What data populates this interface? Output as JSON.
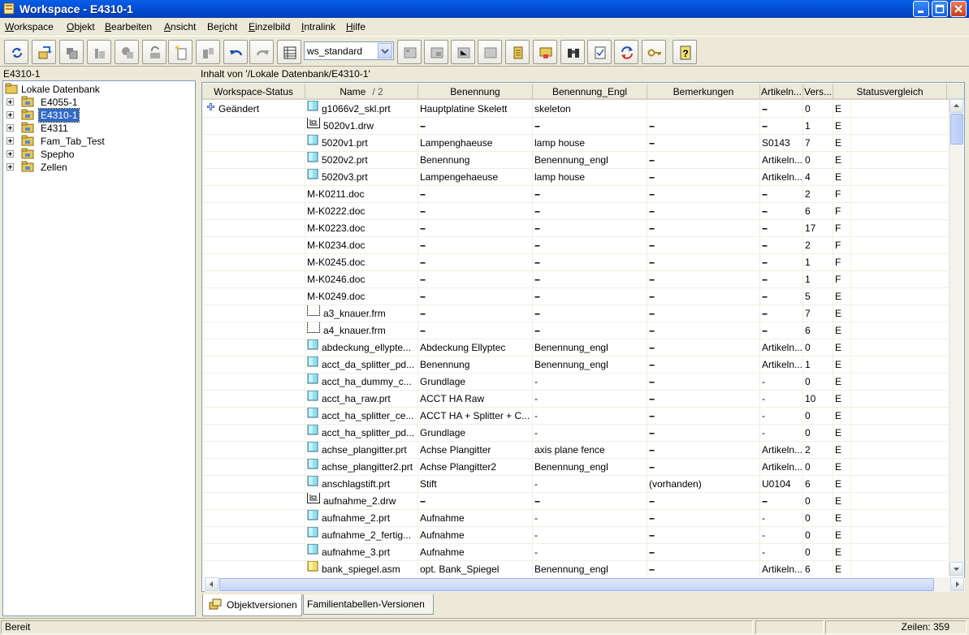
{
  "window": {
    "title": "Workspace - E4310-1"
  },
  "menu": [
    {
      "label": "Workspace",
      "ul": "W",
      "rest": "orkspace"
    },
    {
      "label": "Objekt",
      "ul": "O",
      "rest": "bjekt"
    },
    {
      "label": "Bearbeiten",
      "ul": "B",
      "rest": "earbeiten"
    },
    {
      "label": "Ansicht",
      "ul": "A",
      "rest": "nsicht"
    },
    {
      "label": "Bericht",
      "pre": "Be",
      "ul": "r",
      "rest": "icht"
    },
    {
      "label": "Einzelbild",
      "ul": "E",
      "rest": "inzelbild"
    },
    {
      "label": "Intralink",
      "ul": "I",
      "rest": "ntralink"
    },
    {
      "label": "Hilfe",
      "ul": "H",
      "rest": "ilfe"
    }
  ],
  "toolbar": {
    "view_select": {
      "value": "ws_standard"
    }
  },
  "tree": {
    "header": "E4310-1",
    "root": "Lokale Datenbank",
    "items": [
      "E4055-1",
      "E4310-1",
      "E4311",
      "Fam_Tab_Test",
      "Spepho",
      "Zellen"
    ],
    "selected": "E4310-1"
  },
  "content": {
    "path_label": "Inhalt von '/Lokale Datenbank/E4310-1'",
    "columns": [
      "Workspace-Status",
      "Name",
      "Benennung",
      "Benennung_Engl",
      "Bemerkungen",
      "Artikeln...",
      "Vers...",
      "Statusvergleich"
    ],
    "name_sort": "/  2",
    "rows": [
      {
        "status": "Geändert",
        "icon": "part",
        "name": "g1066v2_skl.prt",
        "ben": "Hauptplatine Skelett",
        "ben_engl": "skeleton",
        "bem": "",
        "art": "--",
        "ver": "0",
        "sv": "E"
      },
      {
        "status": "",
        "icon": "drawing",
        "name": "5020v1.drw",
        "ben": "--",
        "ben_engl": "--",
        "bem": "--",
        "art": "--",
        "ver": "1",
        "sv": "E"
      },
      {
        "status": "",
        "icon": "part",
        "name": "5020v1.prt",
        "ben": "Lampenghaeuse",
        "ben_engl": "lamp house",
        "bem": "--",
        "art": "S0143",
        "ver": "7",
        "sv": "E"
      },
      {
        "status": "",
        "icon": "part",
        "name": "5020v2.prt",
        "ben": "Benennung",
        "ben_engl": "Benennung_engl",
        "bem": "--",
        "art": "Artikeln...",
        "ver": "0",
        "sv": "E"
      },
      {
        "status": "",
        "icon": "part",
        "name": "5020v3.prt",
        "ben": "Lampengehaeuse",
        "ben_engl": "lamp house",
        "bem": "--",
        "art": "Artikeln...",
        "ver": "4",
        "sv": "E"
      },
      {
        "status": "",
        "icon": "",
        "name": "M-K0211.doc",
        "ben": "--",
        "ben_engl": "--",
        "bem": "--",
        "art": "--",
        "ver": "2",
        "sv": "F"
      },
      {
        "status": "",
        "icon": "",
        "name": "M-K0222.doc",
        "ben": "--",
        "ben_engl": "--",
        "bem": "--",
        "art": "--",
        "ver": "6",
        "sv": "F"
      },
      {
        "status": "",
        "icon": "",
        "name": "M-K0223.doc",
        "ben": "--",
        "ben_engl": "--",
        "bem": "--",
        "art": "--",
        "ver": "17",
        "sv": "F"
      },
      {
        "status": "",
        "icon": "",
        "name": "M-K0234.doc",
        "ben": "--",
        "ben_engl": "--",
        "bem": "--",
        "art": "--",
        "ver": "2",
        "sv": "F"
      },
      {
        "status": "",
        "icon": "",
        "name": "M-K0245.doc",
        "ben": "--",
        "ben_engl": "--",
        "bem": "--",
        "art": "--",
        "ver": "1",
        "sv": "F"
      },
      {
        "status": "",
        "icon": "",
        "name": "M-K0246.doc",
        "ben": "--",
        "ben_engl": "--",
        "bem": "--",
        "art": "--",
        "ver": "1",
        "sv": "F"
      },
      {
        "status": "",
        "icon": "",
        "name": "M-K0249.doc",
        "ben": "--",
        "ben_engl": "--",
        "bem": "--",
        "art": "--",
        "ver": "5",
        "sv": "E"
      },
      {
        "status": "",
        "icon": "format",
        "name": "a3_knauer.frm",
        "ben": "--",
        "ben_engl": "--",
        "bem": "--",
        "art": "--",
        "ver": "7",
        "sv": "E"
      },
      {
        "status": "",
        "icon": "format",
        "name": "a4_knauer.frm",
        "ben": "--",
        "ben_engl": "--",
        "bem": "--",
        "art": "--",
        "ver": "6",
        "sv": "E"
      },
      {
        "status": "",
        "icon": "part",
        "name": "abdeckung_ellypte...",
        "ben": "Abdeckung Ellyptec",
        "ben_engl": "Benennung_engl",
        "bem": "--",
        "art": "Artikeln...",
        "ver": "0",
        "sv": "E"
      },
      {
        "status": "",
        "icon": "part",
        "name": "acct_da_splitter_pd...",
        "ben": "Benennung",
        "ben_engl": "Benennung_engl",
        "bem": "--",
        "art": "Artikeln...",
        "ver": "1",
        "sv": "E"
      },
      {
        "status": "",
        "icon": "part",
        "name": "acct_ha_dummy_c...",
        "ben": "Grundlage",
        "ben_engl": "-",
        "bem": "--",
        "art": "-",
        "ver": "0",
        "sv": "E"
      },
      {
        "status": "",
        "icon": "part",
        "name": "acct_ha_raw.prt",
        "ben": "ACCT HA Raw",
        "ben_engl": "-",
        "bem": "--",
        "art": "-",
        "ver": "10",
        "sv": "E"
      },
      {
        "status": "",
        "icon": "part",
        "name": "acct_ha_splitter_ce...",
        "ben": "ACCT HA + Splitter + C...",
        "ben_engl": "-",
        "bem": "--",
        "art": "-",
        "ver": "0",
        "sv": "E"
      },
      {
        "status": "",
        "icon": "part",
        "name": "acct_ha_splitter_pd...",
        "ben": "Grundlage",
        "ben_engl": "-",
        "bem": "--",
        "art": "-",
        "ver": "0",
        "sv": "E"
      },
      {
        "status": "",
        "icon": "part",
        "name": "achse_plangitter.prt",
        "ben": "Achse Plangitter",
        "ben_engl": "axis plane fence",
        "bem": "--",
        "art": "Artikeln...",
        "ver": "2",
        "sv": "E"
      },
      {
        "status": "",
        "icon": "part",
        "name": "achse_plangitter2.prt",
        "ben": "Achse Plangitter2",
        "ben_engl": "Benennung_engl",
        "bem": "--",
        "art": "Artikeln...",
        "ver": "0",
        "sv": "E"
      },
      {
        "status": "",
        "icon": "part",
        "name": "anschlagstift.prt",
        "ben": "Stift",
        "ben_engl": "-",
        "bem": "(vorhanden)",
        "art": "U0104",
        "ver": "6",
        "sv": "E"
      },
      {
        "status": "",
        "icon": "drawing",
        "name": "aufnahme_2.drw",
        "ben": "--",
        "ben_engl": "--",
        "bem": "--",
        "art": "--",
        "ver": "0",
        "sv": "E"
      },
      {
        "status": "",
        "icon": "part",
        "name": "aufnahme_2.prt",
        "ben": "Aufnahme",
        "ben_engl": "-",
        "bem": "--",
        "art": "-",
        "ver": "0",
        "sv": "E"
      },
      {
        "status": "",
        "icon": "part",
        "name": "aufnahme_2_fertig...",
        "ben": "Aufnahme",
        "ben_engl": "-",
        "bem": "--",
        "art": "-",
        "ver": "0",
        "sv": "E"
      },
      {
        "status": "",
        "icon": "part",
        "name": "aufnahme_3.prt",
        "ben": "Aufnahme",
        "ben_engl": "-",
        "bem": "--",
        "art": "-",
        "ver": "0",
        "sv": "E"
      },
      {
        "status": "",
        "icon": "assembly",
        "name": "bank_spiegel.asm",
        "ben": "opt. Bank_Spiegel",
        "ben_engl": "Benennung_engl",
        "bem": "--",
        "art": "Artikeln...",
        "ver": "6",
        "sv": "E"
      }
    ]
  },
  "tabs": [
    "Objektversionen",
    "Familientabellen-Versionen"
  ],
  "status": {
    "left": "Bereit",
    "right": "Zeilen: 359"
  }
}
